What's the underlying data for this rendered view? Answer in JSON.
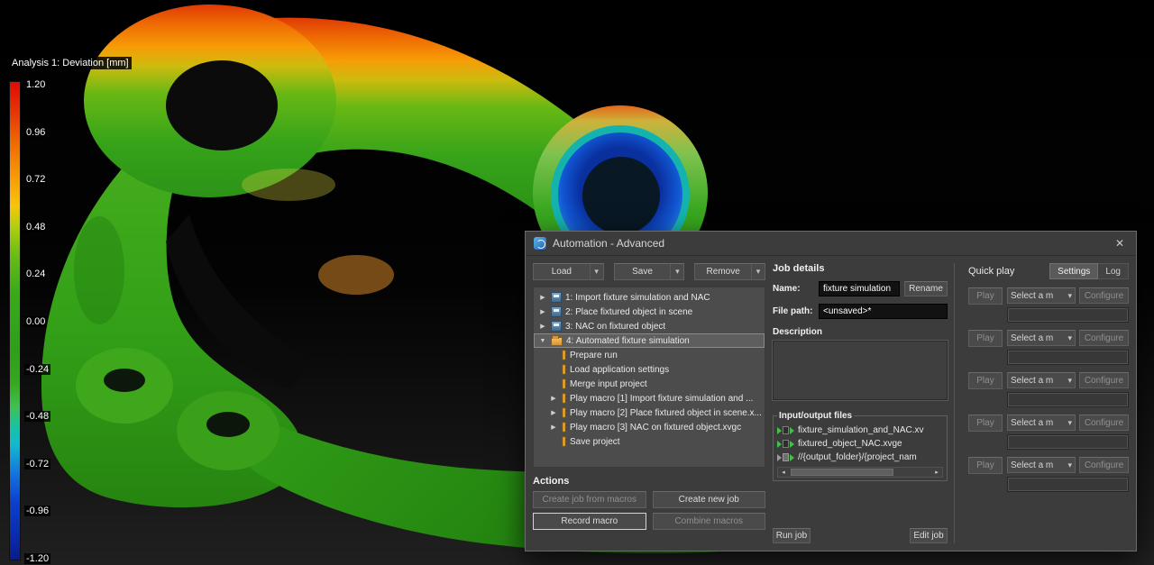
{
  "viewport": {
    "color_scale": {
      "title": "Analysis 1: Deviation [mm]",
      "ticks": [
        "1.20",
        "0.96",
        "0.72",
        "0.48",
        "0.24",
        "0.00",
        "-0.24",
        "-0.48",
        "-0.72",
        "-0.96",
        "-1.20"
      ],
      "colors": {
        "max": "#e00b06",
        "mid": "#2f9e1a",
        "min": "#081c86"
      }
    }
  },
  "dialog": {
    "title": "Automation - Advanced",
    "close": "✕",
    "toolbar": {
      "load": "Load",
      "save": "Save",
      "remove": "Remove"
    },
    "tree": {
      "jobs": [
        {
          "label": "1: Import fixture simulation and NAC"
        },
        {
          "label": "2: Place fixtured object in scene"
        },
        {
          "label": "3: NAC on fixtured object"
        },
        {
          "label": "4: Automated fixture simulation"
        }
      ],
      "steps": [
        {
          "label": "Prepare run"
        },
        {
          "label": "Load application settings"
        },
        {
          "label": "Merge input project"
        },
        {
          "label": "Play macro [1] Import fixture simulation and ..."
        },
        {
          "label": "Play macro [2] Place fixtured object in scene.x..."
        },
        {
          "label": "Play macro [3] NAC on fixtured object.xvgc"
        },
        {
          "label": "Save project"
        }
      ]
    },
    "actions": {
      "header": "Actions",
      "create_job_from_macros": "Create job from macros",
      "create_new_job": "Create new job",
      "record_macro": "Record macro",
      "combine_macros": "Combine macros"
    },
    "job_details": {
      "header": "Job details",
      "name_label": "Name:",
      "name_value": "fixture simulation",
      "rename": "Rename",
      "file_path_label": "File path:",
      "file_path_value": "<unsaved>*",
      "description_label": "Description",
      "io_header": "Input/output files",
      "io_files": [
        {
          "label": "fixture_simulation_and_NAC.xv"
        },
        {
          "label": "fixtured_object_NAC.xvge"
        },
        {
          "label": "//{output_folder}/{project_nam"
        }
      ],
      "run_job": "Run job",
      "edit_job": "Edit job"
    },
    "quick_play": {
      "header": "Quick play",
      "tab_settings": "Settings",
      "tab_log": "Log",
      "rows": [
        {
          "play": "Play",
          "select": "Select a m",
          "configure": "Configure"
        },
        {
          "play": "Play",
          "select": "Select a m",
          "configure": "Configure"
        },
        {
          "play": "Play",
          "select": "Select a m",
          "configure": "Configure"
        },
        {
          "play": "Play",
          "select": "Select a m",
          "configure": "Configure"
        },
        {
          "play": "Play",
          "select": "Select a m",
          "configure": "Configure"
        }
      ]
    }
  }
}
